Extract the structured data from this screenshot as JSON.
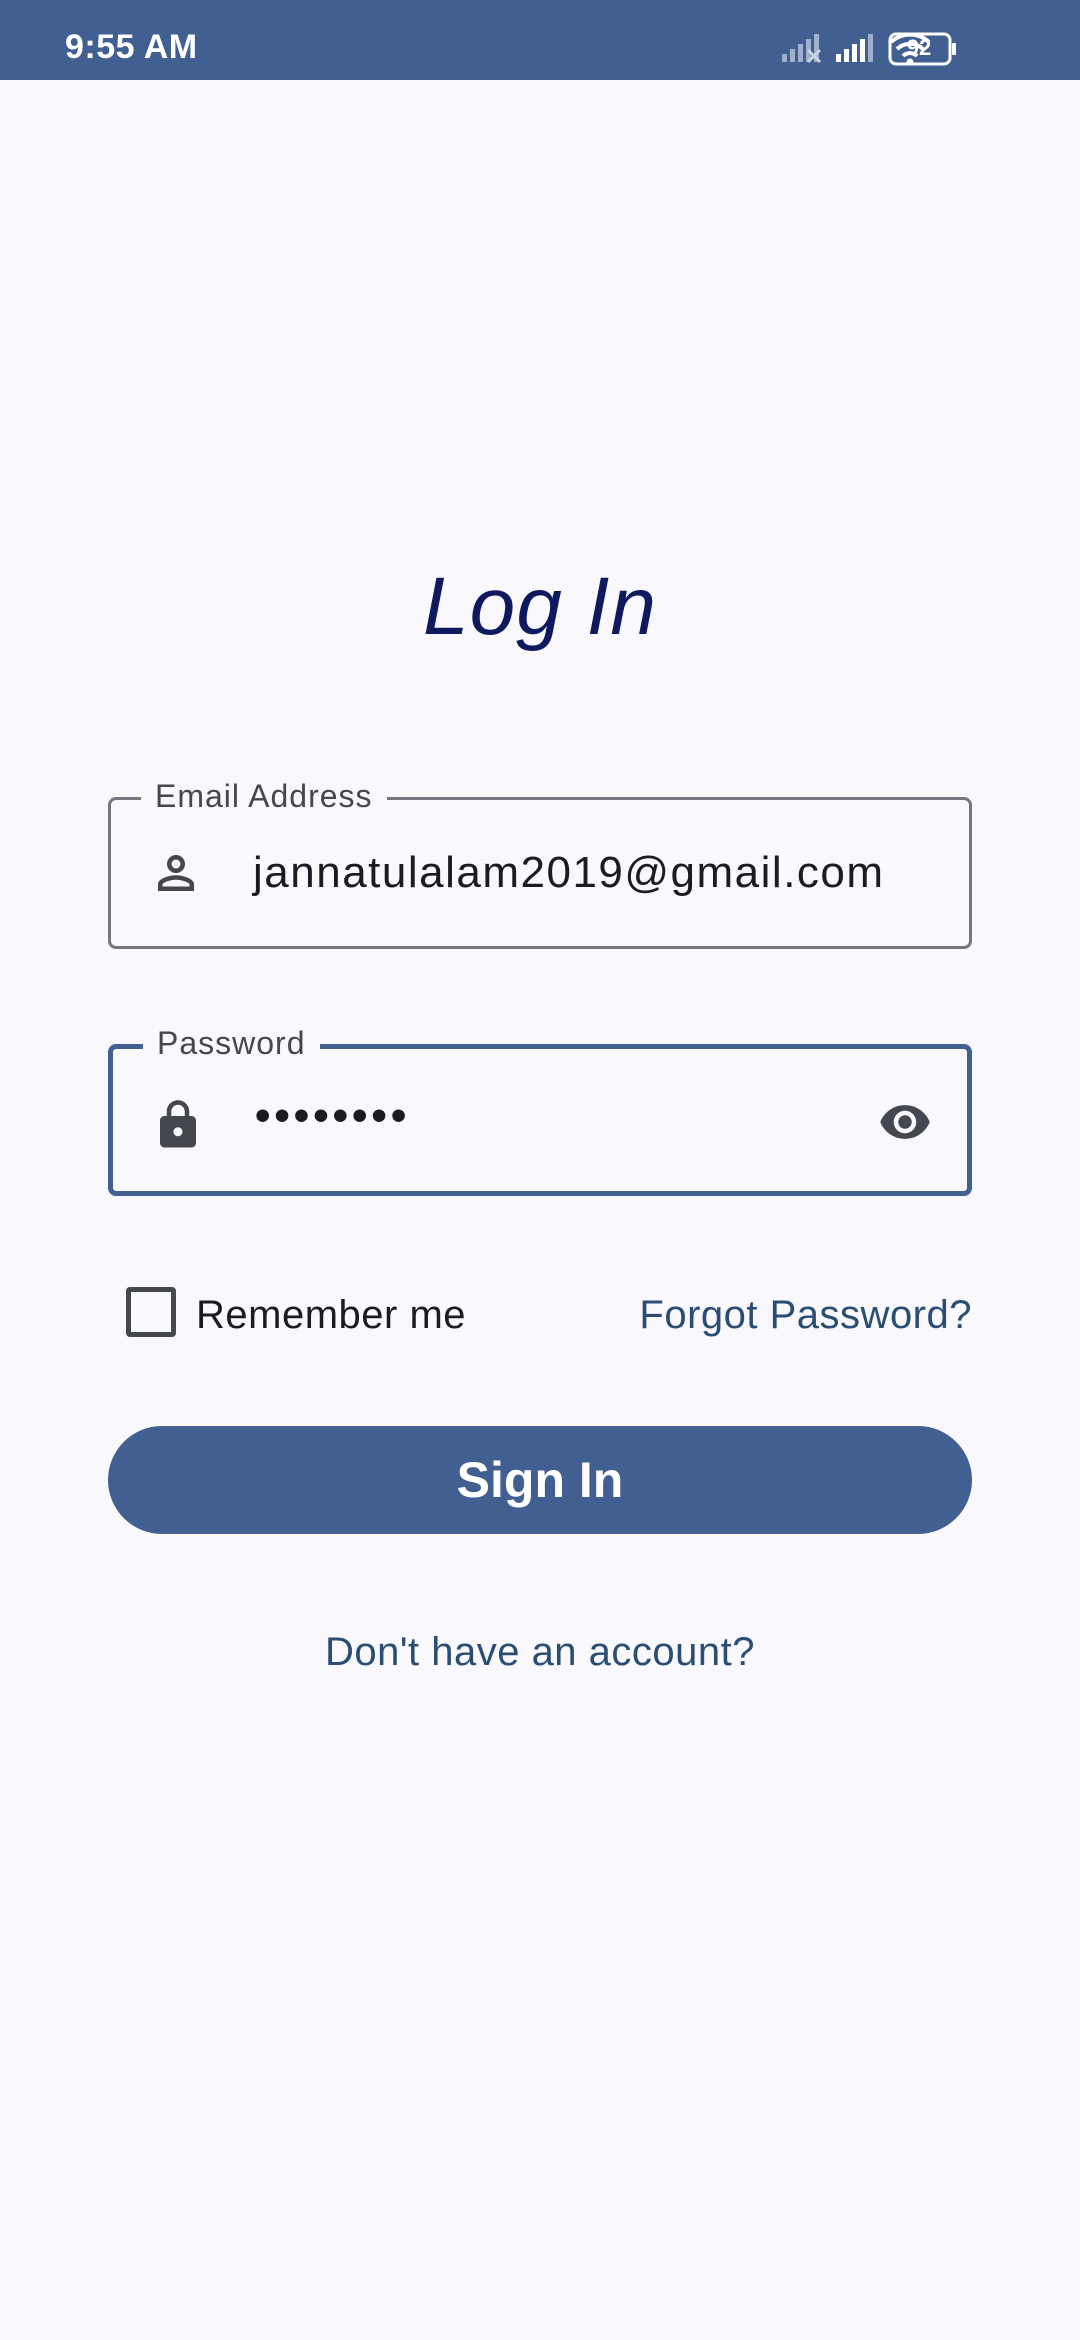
{
  "status_bar": {
    "time": "9:55 AM",
    "battery": "92",
    "icons": [
      "signal-off-icon",
      "signal-icon",
      "wifi-icon",
      "battery-icon"
    ],
    "background": "#415f91"
  },
  "login": {
    "title": "Log In",
    "email": {
      "label": "Email Address",
      "value": "jannatulalam2019@gmail.com",
      "icon": "person-icon"
    },
    "password": {
      "label": "Password",
      "value": "••••••••",
      "icon": "lock-icon",
      "toggle_icon": "eye-icon"
    },
    "remember_me": {
      "label": "Remember me",
      "checked": false
    },
    "forgot_password": "Forgot Password?",
    "sign_in_button": "Sign In",
    "signup_link": "Don't have an account?"
  },
  "colors": {
    "primary": "#415f91",
    "title": "#0f1a5e",
    "link": "#2b4d73",
    "background": "#f8f8fd"
  }
}
